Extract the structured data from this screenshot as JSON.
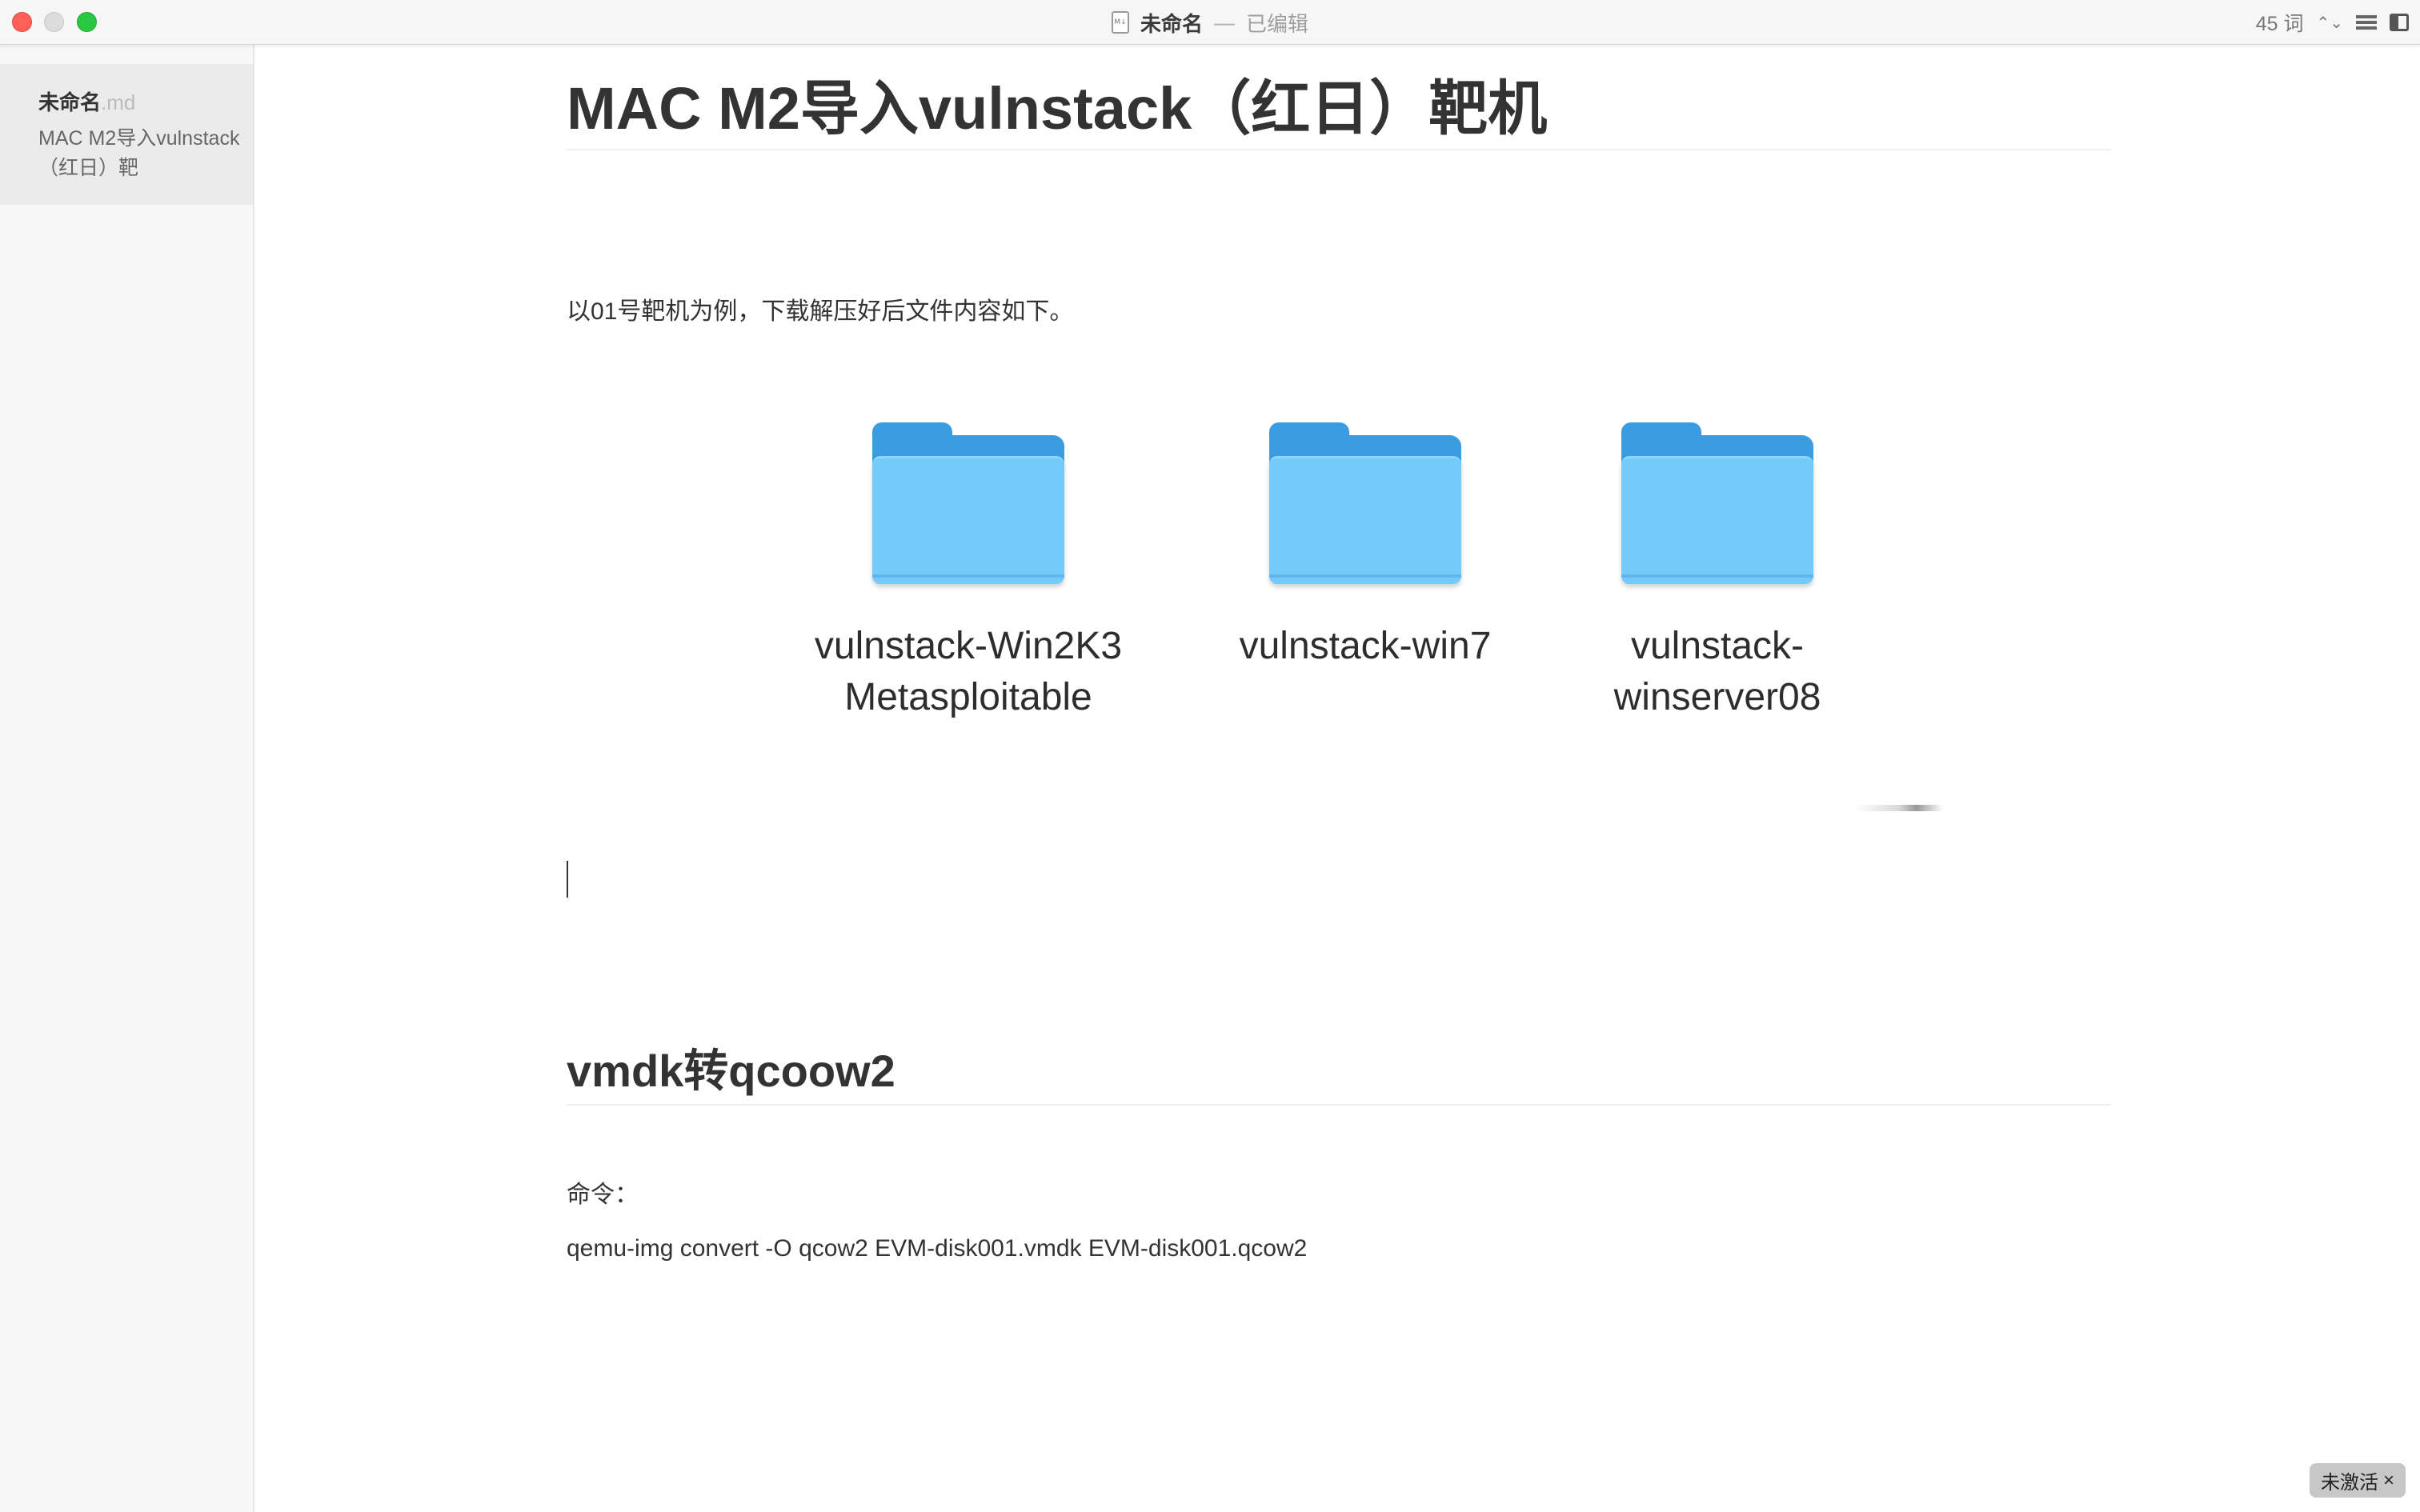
{
  "window": {
    "file_name": "未命名",
    "separator": "—",
    "status": "已编辑",
    "doc_icon_text": "M↓",
    "word_count": "45 词"
  },
  "sidebar": {
    "files": [
      {
        "name": "未命名",
        "ext": ".md",
        "preview": "MAC M2导入vulnstack（红日）靶"
      }
    ]
  },
  "document": {
    "title": "MAC M2导入vulnstack（红日）靶机",
    "intro": "以01号靶机为例，下载解压好后文件内容如下。",
    "folders": [
      {
        "label": "vulnstack-Win2K3\nMetasploitable"
      },
      {
        "label": "vulnstack-win7"
      },
      {
        "label": "vulnstack-\nwinserver08"
      }
    ],
    "section_heading": "vmdk转qcoow2",
    "command_label": "命令：",
    "command": "qemu-img convert -O qcow2 EVM-disk001.vmdk EVM-disk001.qcow2"
  },
  "badge": {
    "label": "未激活",
    "close": "×"
  },
  "colors": {
    "close_button": "#fe5f57",
    "zoom_button": "#28c840",
    "folder_body": "#74cbfa",
    "folder_tab": "#3a9de0"
  }
}
